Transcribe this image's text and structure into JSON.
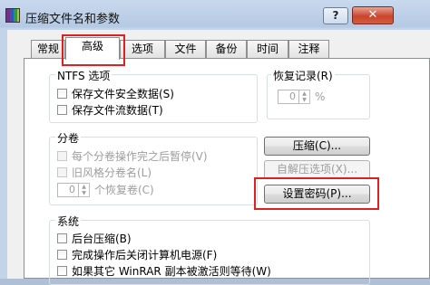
{
  "window": {
    "title": "压缩文件名和参数",
    "help_glyph": "?",
    "close_glyph": "✕"
  },
  "tabs": [
    {
      "label": "常规"
    },
    {
      "label": "高级"
    },
    {
      "label": "选项"
    },
    {
      "label": "文件"
    },
    {
      "label": "备份"
    },
    {
      "label": "时间"
    },
    {
      "label": "注释"
    }
  ],
  "active_tab": "高级",
  "ntfs": {
    "label": "NTFS 选项",
    "save_security": "保存文件安全数据(S)",
    "save_streams": "保存文件流数据(T)"
  },
  "recovery": {
    "label": "恢复记录(R)",
    "value": "0",
    "unit": "%"
  },
  "volumes": {
    "label": "分卷",
    "pause_each": "每个分卷操作完之后暂停(V)",
    "old_naming": "旧风格分卷名(L)",
    "recovery_volumes_value": "0",
    "recovery_volumes_label": "个恢复卷(C)"
  },
  "buttons": {
    "compression": "压缩(C)...",
    "sfx_options": "自解压选项(X)...",
    "set_password": "设置密码(P)..."
  },
  "system": {
    "label": "系统",
    "background": "后台压缩(B)",
    "shutdown": "完成操作后关闭计算机电源(F)",
    "wait_other": "如果其它 WinRAR 副本被激活则等待(W)"
  },
  "highlight_color": "#e02020"
}
